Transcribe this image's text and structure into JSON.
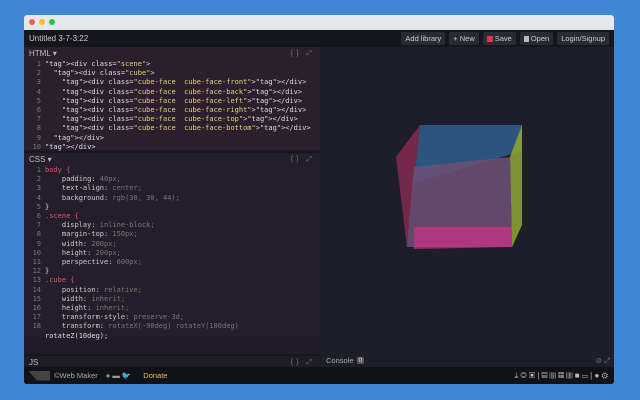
{
  "window": {
    "title": "Untitled 3-7-3:22"
  },
  "toolbar": {
    "add_library": "Add library",
    "new": "+ New",
    "save": "Save",
    "open": "Open",
    "login": "Login/Signup"
  },
  "panels": {
    "html": "HTML ▾",
    "css": "CSS ▾",
    "js": "JS",
    "console": "Console",
    "console_count": "0",
    "panel_icons": "{} ⤢"
  },
  "html_code": [
    [
      "1",
      "<div class=\"scene\">"
    ],
    [
      "2",
      "  <div class=\"cube\">"
    ],
    [
      "3",
      "    <div class=\"cube-face  cube-face-front\"></div>"
    ],
    [
      "4",
      "    <div class=\"cube-face  cube-face-back\"></div>"
    ],
    [
      "5",
      "    <div class=\"cube-face  cube-face-left\"></div>"
    ],
    [
      "6",
      "    <div class=\"cube-face  cube-face-right\"></div>"
    ],
    [
      "7",
      "    <div class=\"cube-face  cube-face-top\"></div>"
    ],
    [
      "8",
      "    <div class=\"cube-face  cube-face-bottom\"></div>"
    ],
    [
      "9",
      "  </div>"
    ],
    [
      "10",
      "</div>"
    ]
  ],
  "css_code": [
    [
      "1",
      "body {"
    ],
    [
      "2",
      "    padding: 40px;"
    ],
    [
      "3",
      "    text-align: center;"
    ],
    [
      "4",
      "    background: rgb(30, 30, 44);"
    ],
    [
      "5",
      "}"
    ],
    [
      "6",
      ".scene {"
    ],
    [
      "7",
      "    display: inline-block;"
    ],
    [
      "8",
      "    margin-top: 150px;"
    ],
    [
      "9",
      "    width: 200px;"
    ],
    [
      "10",
      "    height: 200px;"
    ],
    [
      "11",
      "    perspective: 600px;"
    ],
    [
      "12",
      "}"
    ],
    [
      "13",
      ".cube {"
    ],
    [
      "14",
      "    position: relative;"
    ],
    [
      "15",
      "    width: inherit;"
    ],
    [
      "16",
      "    height: inherit;"
    ],
    [
      "17",
      "    transform-style: preserve-3d;"
    ],
    [
      "18",
      "    transform: rotateX(-90deg) rotateY(180deg)"
    ],
    [
      "",
      "rotateZ(10deg);"
    ]
  ],
  "footer": {
    "brand": "©Web Maker",
    "donate": "Donate",
    "icons": "⤓ ◎ ▣ | ▤ ▥ ▦ ▥ ■ ▭ | ● ⚙"
  },
  "colors": {
    "accent_donate": "#e0c24a",
    "save_red": "#e0334d"
  }
}
